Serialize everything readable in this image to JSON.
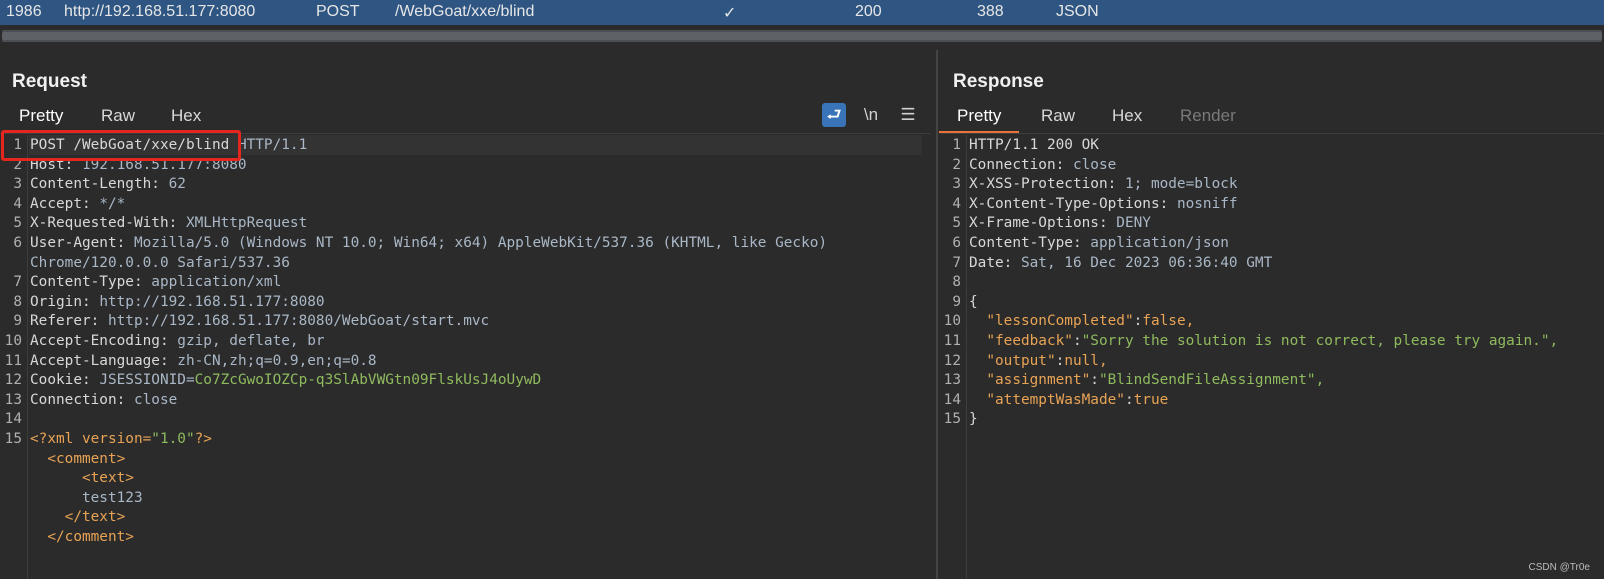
{
  "history_row": {
    "id": "1986",
    "host": "http://192.168.51.177:8080",
    "method": "POST",
    "url": "/WebGoat/xxe/blind",
    "check": "✓",
    "status": "200",
    "length": "388",
    "mime": "JSON"
  },
  "request": {
    "title": "Request",
    "tabs": [
      "Pretty",
      "Raw",
      "Hex"
    ],
    "tools": {
      "wrap_icon": "⮐",
      "newline_label": "\\n",
      "menu_icon": "☰"
    },
    "lines": [
      {
        "n": "1",
        "a": "POST /WebGoat/xxe/blind ",
        "b": "HTTP/1.1",
        "c": ""
      },
      {
        "n": "2",
        "a": "Host: ",
        "b": "192.168.51.177:8080",
        "c": ""
      },
      {
        "n": "3",
        "a": "Content-Length: ",
        "b": "62",
        "c": ""
      },
      {
        "n": "4",
        "a": "Accept: ",
        "b": "*/*",
        "c": ""
      },
      {
        "n": "5",
        "a": "X-Requested-With: ",
        "b": "XMLHttpRequest",
        "c": ""
      },
      {
        "n": "6",
        "a": "User-Agent: ",
        "b": "Mozilla/5.0 (Windows NT 10.0; Win64; x64) AppleWebKit/537.36 (KHTML, like Gecko)",
        "c": ""
      },
      {
        "n": "",
        "a": "",
        "b": "Chrome/120.0.0.0 Safari/537.36",
        "c": ""
      },
      {
        "n": "7",
        "a": "Content-Type: ",
        "b": "application/xml",
        "c": ""
      },
      {
        "n": "8",
        "a": "Origin: ",
        "b": "http://192.168.51.177:8080",
        "c": ""
      },
      {
        "n": "9",
        "a": "Referer: ",
        "b": "http://192.168.51.177:8080/WebGoat/start.mvc",
        "c": ""
      },
      {
        "n": "10",
        "a": "Accept-Encoding: ",
        "b": "gzip, deflate, br",
        "c": ""
      },
      {
        "n": "11",
        "a": "Accept-Language: ",
        "b": "zh-CN,zh;q=0.9,en;q=0.8",
        "c": ""
      },
      {
        "n": "12",
        "a": "Cookie: ",
        "b": "JSESSIONID=",
        "c": "Co7ZcGwoIOZCp-q3SlAbVWGtn09FlskUsJ4oUywD"
      },
      {
        "n": "13",
        "a": "Connection: ",
        "b": "close",
        "c": ""
      },
      {
        "n": "14",
        "a": "",
        "b": "",
        "c": ""
      },
      {
        "n": "15",
        "a": "<?xml version=",
        "b": "\"1.0\"",
        "c": "?>"
      },
      {
        "n": "",
        "a": "  <comment>",
        "b": "",
        "c": ""
      },
      {
        "n": "",
        "a": "      <text>",
        "b": "",
        "c": ""
      },
      {
        "n": "",
        "a": "",
        "b": "      test123",
        "c": ""
      },
      {
        "n": "",
        "a": "    </text>",
        "b": "",
        "c": ""
      },
      {
        "n": "",
        "a": "  </comment>",
        "b": "",
        "c": ""
      }
    ]
  },
  "response": {
    "title": "Response",
    "tabs": [
      "Pretty",
      "Raw",
      "Hex",
      "Render"
    ],
    "lines": [
      {
        "n": "1",
        "a": "HTTP/1.1 200 OK",
        "b": "",
        "c": ""
      },
      {
        "n": "2",
        "a": "Connection: ",
        "b": "close",
        "c": ""
      },
      {
        "n": "3",
        "a": "X-XSS-Protection: ",
        "b": "1; mode=block",
        "c": ""
      },
      {
        "n": "4",
        "a": "X-Content-Type-Options: ",
        "b": "nosniff",
        "c": ""
      },
      {
        "n": "5",
        "a": "X-Frame-Options: ",
        "b": "DENY",
        "c": ""
      },
      {
        "n": "6",
        "a": "Content-Type: ",
        "b": "application/json",
        "c": ""
      },
      {
        "n": "7",
        "a": "Date: ",
        "b": "Sat, 16 Dec 2023 06:36:40 GMT",
        "c": ""
      },
      {
        "n": "8",
        "a": "",
        "b": "",
        "c": ""
      },
      {
        "n": "9",
        "a": "{",
        "b": "",
        "c": ""
      },
      {
        "n": "10",
        "a": "  \"lessonCompleted\"",
        "b": ":",
        "c": "false,"
      },
      {
        "n": "11",
        "a": "  \"feedback\"",
        "b": ":",
        "c": "\"Sorry the solution is not correct, please try again.\","
      },
      {
        "n": "12",
        "a": "  \"output\"",
        "b": ":",
        "c": "null,"
      },
      {
        "n": "13",
        "a": "  \"assignment\"",
        "b": ":",
        "c": "\"BlindSendFileAssignment\","
      },
      {
        "n": "14",
        "a": "  \"attemptWasMade\"",
        "b": ":",
        "c": "true"
      },
      {
        "n": "15",
        "a": "}",
        "b": "",
        "c": ""
      }
    ]
  },
  "watermark": "CSDN @Tr0e",
  "colors": {
    "accent_tab": "#e8743b",
    "highlight_box": "#e5261e",
    "selected_row": "#2f5683"
  }
}
